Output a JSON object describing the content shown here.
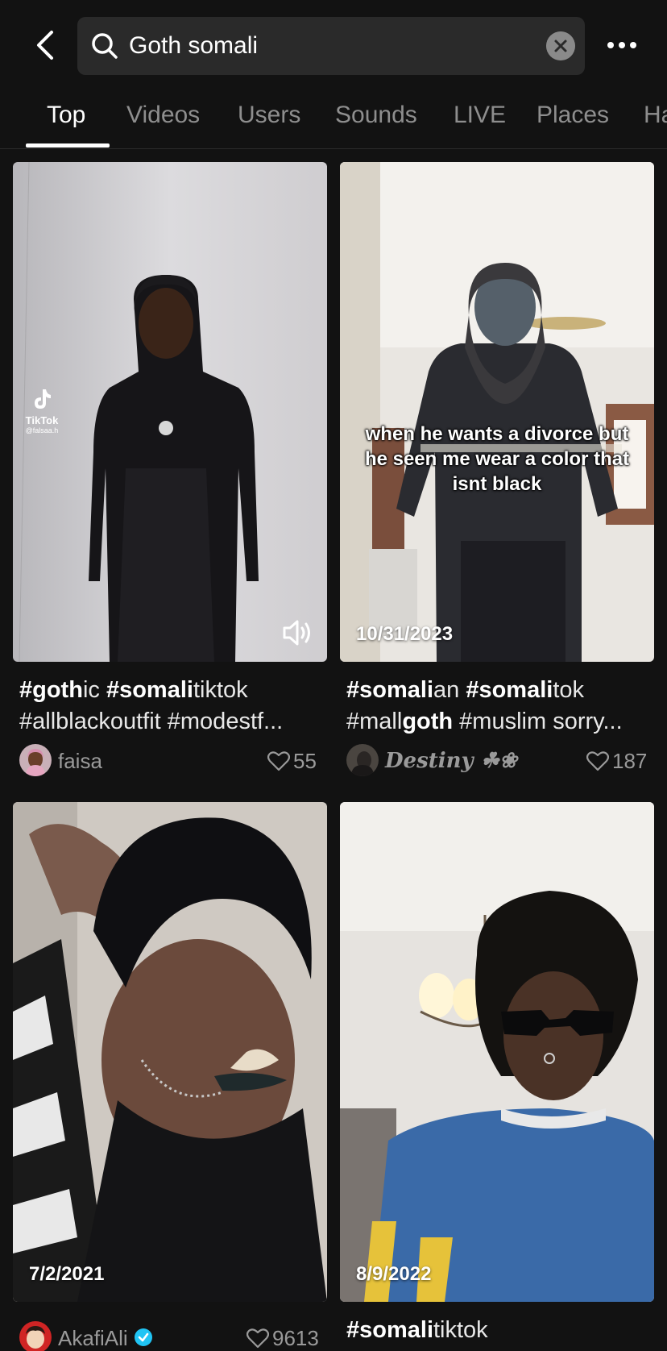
{
  "search": {
    "query": "Goth somali",
    "back_icon": "chevron-left-icon",
    "search_icon": "search-icon",
    "clear_icon": "close-circle-icon",
    "more_icon": "more-horizontal-icon"
  },
  "tabs": [
    {
      "label": "Top",
      "active": true
    },
    {
      "label": "Videos",
      "active": false
    },
    {
      "label": "Users",
      "active": false
    },
    {
      "label": "Sounds",
      "active": false
    },
    {
      "label": "LIVE",
      "active": false
    },
    {
      "label": "Places",
      "active": false
    },
    {
      "label": "Ha",
      "active": false
    }
  ],
  "videos": [
    {
      "caption_parts": [
        [
          "#goth",
          true
        ],
        [
          "ic ",
          false
        ],
        [
          "#somali",
          true
        ],
        [
          "tiktok ",
          false
        ],
        [
          "#allblackoutfit #modestf...",
          false
        ]
      ],
      "watermark_brand": "TikTok",
      "watermark_handle": "@falsaa.h",
      "author": "faisa",
      "likes": "55",
      "sound_icon": "speaker-icon"
    },
    {
      "date": "10/31/2023",
      "overlay_text": "when he wants a divorce but he seen me wear a color that isnt black",
      "caption_parts": [
        [
          "#somali",
          true
        ],
        [
          "an ",
          false
        ],
        [
          "#somali",
          true
        ],
        [
          "tok ",
          false
        ],
        [
          "#mall",
          false
        ],
        [
          "goth",
          true
        ],
        [
          " #muslim sorry...",
          false
        ]
      ],
      "author": "𝑫𝒆𝒔𝒕𝒊𝒏𝒚 ☘❀",
      "likes": "187"
    },
    {
      "date": "7/2/2021",
      "author": "AkafiAli",
      "verified": true,
      "likes": "9613"
    },
    {
      "date": "8/9/2022",
      "caption_parts": [
        [
          "#somali",
          true
        ],
        [
          "tiktok",
          false
        ]
      ]
    }
  ],
  "colors": {
    "background": "#121212",
    "search_bg": "#2a2a2a",
    "tab_inactive": "#8e8e8e",
    "verified": "#20c4f4"
  }
}
